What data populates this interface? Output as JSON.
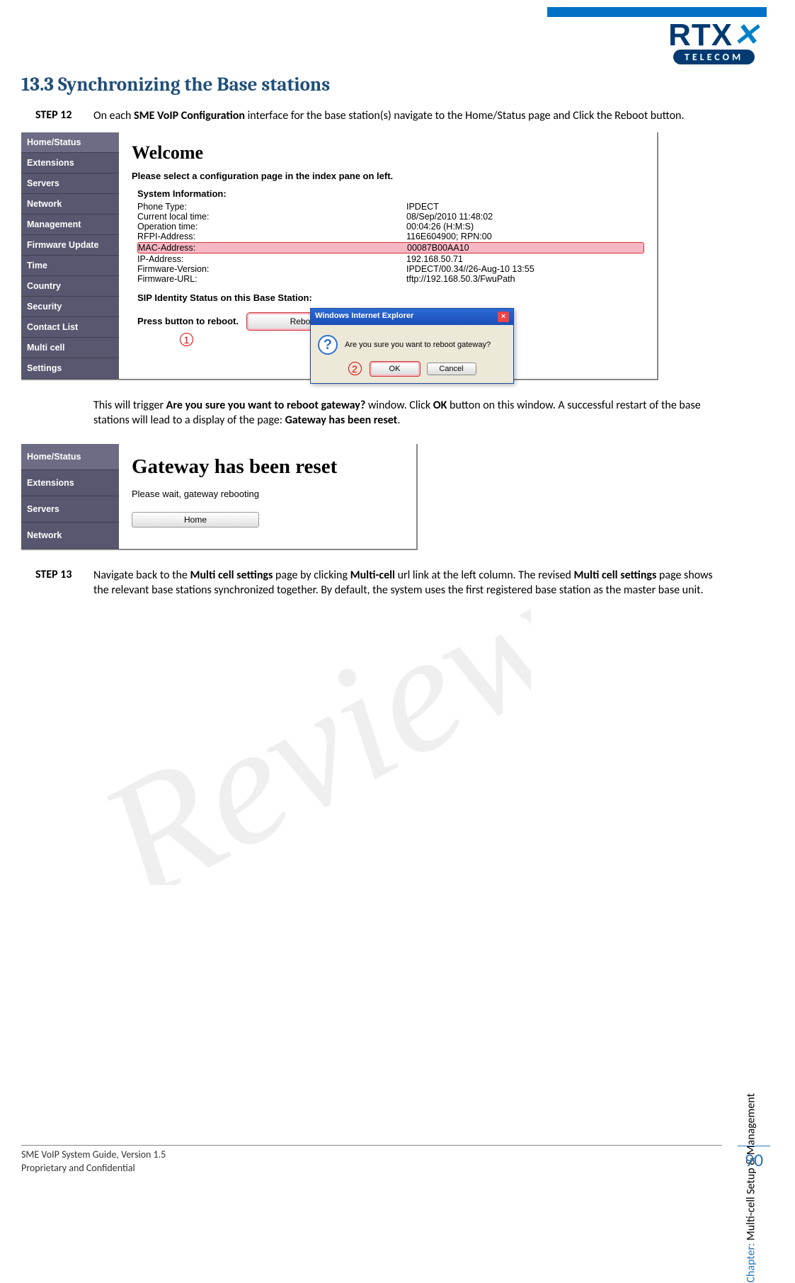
{
  "branding": {
    "logo_main": "RTX",
    "logo_sub": "TELECOM"
  },
  "section": {
    "number": "13.3",
    "title": "Synchronizing the Base stations"
  },
  "step12": {
    "label": "STEP 12",
    "text_pre": "On each ",
    "text_bold1": "SME VoIP Configuration",
    "text_post1": " interface for the base station(s) navigate to the Home/Status page and Click the Reboot button."
  },
  "shot1": {
    "nav": [
      "Home/Status",
      "Extensions",
      "Servers",
      "Network",
      "Management",
      "Firmware Update",
      "Time",
      "Country",
      "Security",
      "Contact List",
      "Multi cell",
      "Settings"
    ],
    "welcome": "Welcome",
    "select_text": "Please select a configuration page in the index pane on left.",
    "sys_head": "System Information:",
    "rows": [
      {
        "label": "Phone Type:",
        "val": "IPDECT"
      },
      {
        "label": "Current local time:",
        "val": "08/Sep/2010 11:48:02"
      },
      {
        "label": "Operation time:",
        "val": "00:04:26 (H:M:S)"
      },
      {
        "label": "RFPI-Address:",
        "val": "116E604900; RPN:00"
      },
      {
        "label": "MAC-Address:",
        "val": "00087B00AA10",
        "hl": true
      },
      {
        "label": "IP-Address:",
        "val": "192.168.50.71"
      },
      {
        "label": "Firmware-Version:",
        "val": "IPDECT/00.34//26-Aug-10 13:55"
      },
      {
        "label": "Firmware-URL:",
        "val": "tftp://192.168.50.3/FwuPath"
      }
    ],
    "sip_head": "SIP Identity Status on this Base Station:",
    "reboot_label": "Press button to reboot.",
    "reboot_btn": "Reboot",
    "ann1": "1",
    "dialog": {
      "title": "Windows Internet Explorer",
      "msg": "Are you sure you want to reboot gateway?",
      "ok": "OK",
      "cancel": "Cancel",
      "ann2": "2"
    }
  },
  "after1_p1a": "This will trigger ",
  "after1_b1": "Are you sure you want to reboot gateway?",
  "after1_p1b": " window. Click ",
  "after1_b2": "OK",
  "after1_p1c": " button on this window. A successful restart of the base stations will lead to a display of the page: ",
  "after1_b3": "Gateway has been reset",
  "after1_p1d": ".",
  "shot2": {
    "nav": [
      "Home/Status",
      "Extensions",
      "Servers",
      "Network"
    ],
    "title": "Gateway has been reset",
    "wait": "Please wait, gateway rebooting",
    "home_btn": "Home"
  },
  "step13": {
    "label": "STEP 13",
    "t1": "Navigate back to the ",
    "b1": "Multi cell settings",
    "t2": " page by clicking ",
    "b2": "Multi-cell",
    "t3": " url link at the left column. The revised ",
    "b3": "Multi cell settings",
    "t4": " page shows the relevant base stations synchronized together. By default, the system uses the first registered base station as the master base unit."
  },
  "side": {
    "label": "Chapter:",
    "text": "Multi-cell Setup & Management"
  },
  "footer": {
    "l1": "SME VoIP System Guide, Version 1.5",
    "l2": "Proprietary and Confidential"
  },
  "page": "90"
}
